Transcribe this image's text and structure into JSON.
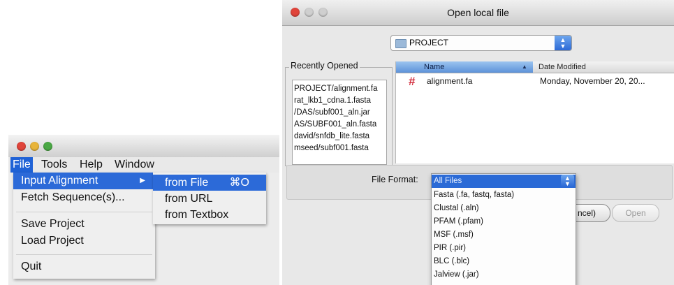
{
  "menu_window": {
    "menubar": [
      "File",
      "Tools",
      "Help",
      "Window"
    ],
    "file_menu": [
      {
        "label": "Input Alignment",
        "has_submenu": true
      },
      {
        "label": "Fetch Sequence(s)..."
      },
      {
        "label": "Save Project"
      },
      {
        "label": "Load Project"
      },
      {
        "label": "Quit"
      }
    ],
    "submenu": [
      {
        "label": "from File",
        "shortcut": "⌘O"
      },
      {
        "label": "from URL"
      },
      {
        "label": "from Textbox"
      }
    ]
  },
  "dialog": {
    "title": "Open local file",
    "folder": "PROJECT",
    "recent_label": "Recently Opened",
    "recent_items": [
      "PROJECT/alignment.fa",
      "rat_lkb1_cdna.1.fasta",
      "/DAS/subf001_aln.jar",
      "AS/SUBF001_aln.fasta",
      "david/snfdb_lite.fasta",
      "mseed/subf001.fasta"
    ],
    "columns": {
      "name": "Name",
      "date": "Date Modified"
    },
    "files": [
      {
        "name": "alignment.fa",
        "date": "Monday, November 20, 20..."
      }
    ],
    "format_label": "File Format:",
    "format_selected": "All Files",
    "format_options": [
      "All Files",
      "Fasta (.fa, fastq, fasta)",
      "Clustal (.aln)",
      "PFAM (.pfam)",
      "MSF (.msf)",
      "PIR (.pir)",
      "BLC (.blc)",
      "Jalview (.jar)"
    ],
    "cancel_label": "ncel)",
    "open_label": "Open"
  },
  "colors": {
    "selection": "#2c6ad8",
    "close_light": "#e0443a",
    "minimize_light": "#e8b43a",
    "zoom_light": "#4aa844"
  }
}
